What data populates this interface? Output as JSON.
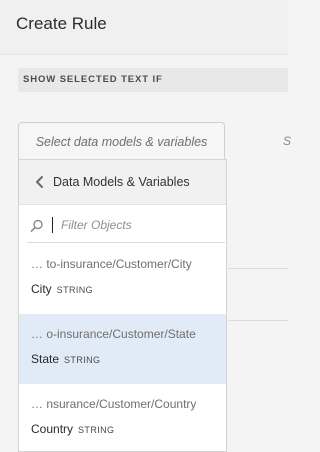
{
  "header": {
    "title": "Create Rule"
  },
  "section": {
    "label": "SHOW SELECTED TEXT IF"
  },
  "right_panel": {
    "placeholder_fragment": "S"
  },
  "selector": {
    "label": "Select data models & variables"
  },
  "popover": {
    "title": "Data Models & Variables",
    "search_placeholder": "Filter Objects",
    "items": [
      {
        "path": "… to-insurance/Customer/City",
        "name": "City",
        "type": "STRING",
        "selected": false
      },
      {
        "path": "… o-insurance/Customer/State",
        "name": "State",
        "type": "STRING",
        "selected": true
      },
      {
        "path": "… nsurance/Customer/Country",
        "name": "Country",
        "type": "STRING",
        "selected": false
      }
    ]
  },
  "colors": {
    "selected_row": "#e1ebf7",
    "header_bg": "#f0f0f0",
    "section_bg": "#e8e8e8"
  },
  "icons": {
    "back": "chevron-left-icon",
    "search": "search-icon"
  }
}
